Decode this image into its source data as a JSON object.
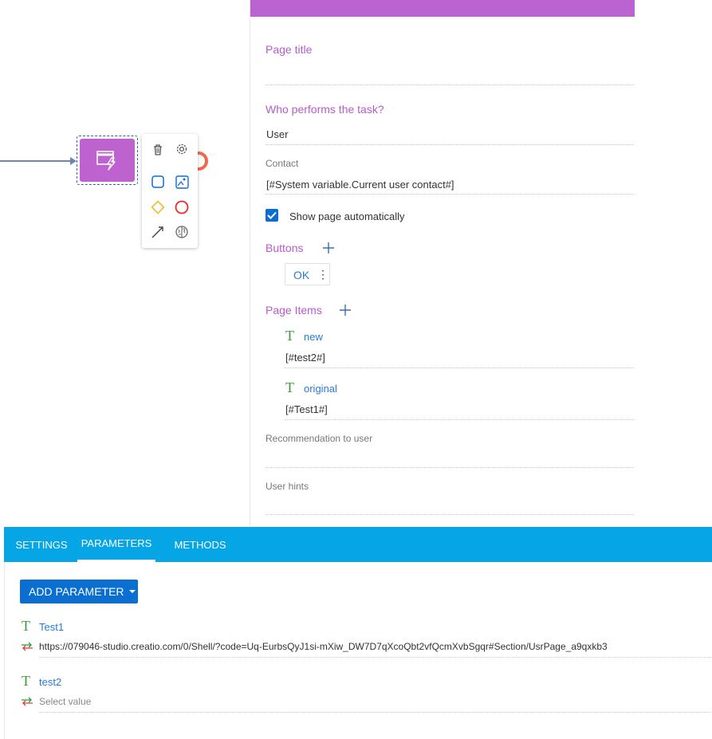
{
  "panel": {
    "page_title_label": "Page title",
    "page_title_value": "",
    "who_performs_label": "Who performs the task?",
    "who_performs_value": "User",
    "contact_label": "Contact",
    "contact_value": "[#System variable.Current user contact#]",
    "show_page_label": "Show page automatically",
    "show_page_checked": true,
    "buttons_label": "Buttons",
    "buttons": [
      {
        "label": "OK"
      }
    ],
    "page_items_label": "Page Items",
    "page_items": [
      {
        "name": "new",
        "value": "[#test2#]"
      },
      {
        "name": "original",
        "value": "[#Test1#]"
      }
    ],
    "recommendation_label": "Recommendation to user",
    "recommendation_value": "",
    "user_hints_label": "User hints",
    "user_hints_value": ""
  },
  "bottom": {
    "tabs": [
      {
        "label": "SETTINGS",
        "active": false
      },
      {
        "label": "PARAMETERS",
        "active": true
      },
      {
        "label": "METHODS",
        "active": false
      }
    ],
    "add_parameter_label": "ADD PARAMETER",
    "parameters": [
      {
        "name": "Test1",
        "value": "https://079046-studio.creatio.com/0/Shell/?code=Uq-EurbsQyJ1si-mXiw_DW7D7qXcoQbt2vfQcmXvbSgqr#Section/UsrPage_a9qxkb3"
      },
      {
        "name": "test2",
        "value": "Select value"
      }
    ]
  },
  "palette": {
    "icons": [
      "trash-icon",
      "gear-icon",
      "task-square-icon",
      "image-script-icon",
      "gateway-diamond-icon",
      "end-event-circle-icon",
      "connector-arrow-icon",
      "brain-icon"
    ]
  },
  "colors": {
    "accent_purple": "#bb63d1",
    "tab_blue": "#06a5e6",
    "button_blue": "#0b6fd1",
    "link_blue": "#2a7ad5",
    "end_event_red": "#f06a4a"
  }
}
